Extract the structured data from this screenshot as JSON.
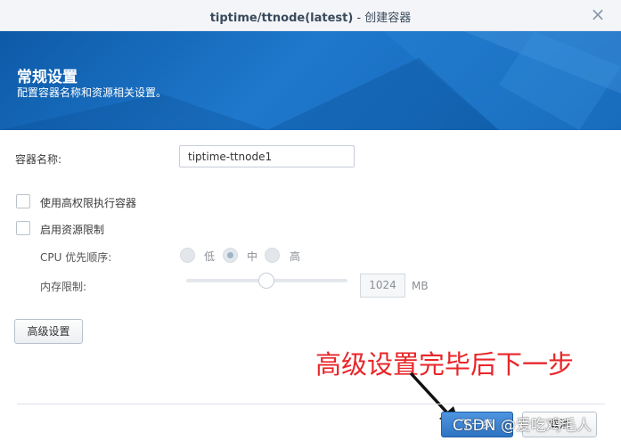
{
  "window": {
    "title_main": "tiptime/ttnode(latest)",
    "title_sep": " - ",
    "title_sub": "创建容器",
    "close_icon": "close-icon"
  },
  "banner": {
    "heading": "常规设置",
    "subheading": "配置容器名称和资源相关设置。"
  },
  "form": {
    "container_name_label": "容器名称:",
    "container_name_value": "tiptime-ttnode1",
    "high_privilege_label": "使用高权限执行容器",
    "high_privilege_checked": false,
    "resource_limit_label": "启用资源限制",
    "resource_limit_checked": false,
    "cpu_priority_label": "CPU 优先顺序:",
    "cpu_options": [
      "低",
      "中",
      "高"
    ],
    "cpu_selected": "中",
    "memory_limit_label": "内存限制:",
    "memory_value": "1024",
    "memory_unit": "MB"
  },
  "buttons": {
    "advanced": "高级设置",
    "next": "下一步",
    "cancel": "取消"
  },
  "annotation": {
    "text": "高级设置完毕后下一步",
    "color": "#e8262a"
  },
  "watermark": "CSDN @爱吃鸡毛人"
}
